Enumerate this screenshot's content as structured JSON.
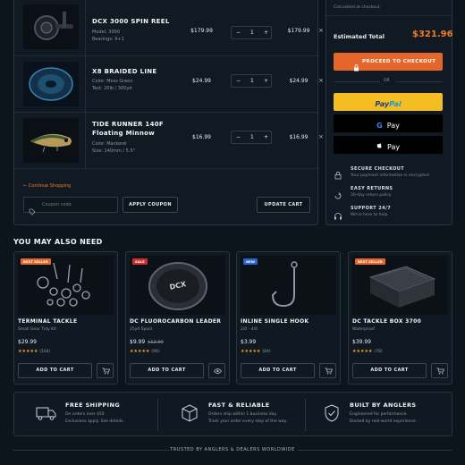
{
  "cart": {
    "items": [
      {
        "name": "DCX 3000 SPIN REEL",
        "meta1": "Model: 3000",
        "meta2": "Bearings: 9+1",
        "price": "$179.99",
        "qty": "1",
        "total": "$179.99"
      },
      {
        "name": "X8 BRAIDED LINE",
        "meta1": "Color: Moss Green",
        "meta2": "Test: 20lb / 300yd",
        "price": "$24.99",
        "qty": "1",
        "total": "$24.99"
      },
      {
        "name_line1": "TIDE RUNNER 140F",
        "name_line2": "Floating Minnow",
        "meta1": "Color: Mackerel",
        "meta2": "Size: 140mm / 5.5\"",
        "price": "$16.99",
        "qty": "1",
        "total": "$16.99"
      }
    ],
    "minus": "−",
    "plus": "+",
    "remove": "×",
    "continue": "← Continue Shopping",
    "coupon_placeholder": "Coupon code",
    "apply": "APPLY COUPON",
    "update": "UPDATE CART"
  },
  "summary": {
    "calculated": "Calculated at checkout",
    "total_label": "Estimated Total",
    "total_value": "$321.96",
    "checkout": "PROCEED TO CHECKOUT",
    "or": "OR",
    "paypal_a": "Pay",
    "paypal_b": "Pal",
    "gpay_g": "G",
    "gpay_label": "Pay",
    "apay_label": "Pay",
    "secure_title": "SECURE CHECKOUT",
    "secure_sub": "Your payment information is encrypted",
    "returns_title": "EASY RETURNS",
    "returns_sub": "30-day return policy",
    "support_title": "SUPPORT 24/7",
    "support_sub": "We're here to help"
  },
  "recs": {
    "heading": "YOU MAY ALSO NEED",
    "add": "ADD TO CART",
    "items": [
      {
        "badge": "BEST SELLER",
        "badge_color": "#e4662a",
        "name": "TERMINAL TACKLE",
        "sub": "Small Gear Tidy Kit",
        "price": "$29.99",
        "old": "",
        "stars": "★★★★★",
        "reviews": "(164)"
      },
      {
        "badge": "SALE",
        "badge_color": "#c9302c",
        "name": "DC FLUOROCARBON LEADER",
        "sub": "25yd Spool",
        "price": "$9.99",
        "old": "$12.99",
        "stars": "★★★★★",
        "reviews": "(96)"
      },
      {
        "badge": "NEW",
        "badge_color": "#2b63c9",
        "name": "INLINE SINGLE HOOK",
        "sub": "2/0 - 4/0",
        "price": "$3.99",
        "old": "",
        "stars": "★★★★★",
        "reviews": "(84)"
      },
      {
        "badge": "BEST SELLER",
        "badge_color": "#e4662a",
        "name": "DC TACKLE BOX 3700",
        "sub": "Waterproof",
        "price": "$39.99",
        "old": "",
        "stars": "★★★★★",
        "reviews": "(78)"
      }
    ]
  },
  "features": [
    {
      "title": "FREE SHIPPING",
      "line1": "On orders over $50",
      "line2": "Exclusions apply. See details."
    },
    {
      "title": "FAST & RELIABLE",
      "line1": "Orders ship within 1 business day.",
      "line2": "Track your order every step of the way."
    },
    {
      "title": "BUILT BY ANGLERS",
      "line1": "Engineered for performance.",
      "line2": "Backed by real-world experience."
    }
  ],
  "trusted": "TRUSTED BY ANGLERS & DEALERS WORLDWIDE",
  "colors": {
    "accent": "#e4662a",
    "total": "#f07a2e",
    "paypal_bg": "#f5bd24",
    "star": "#f0a032"
  }
}
